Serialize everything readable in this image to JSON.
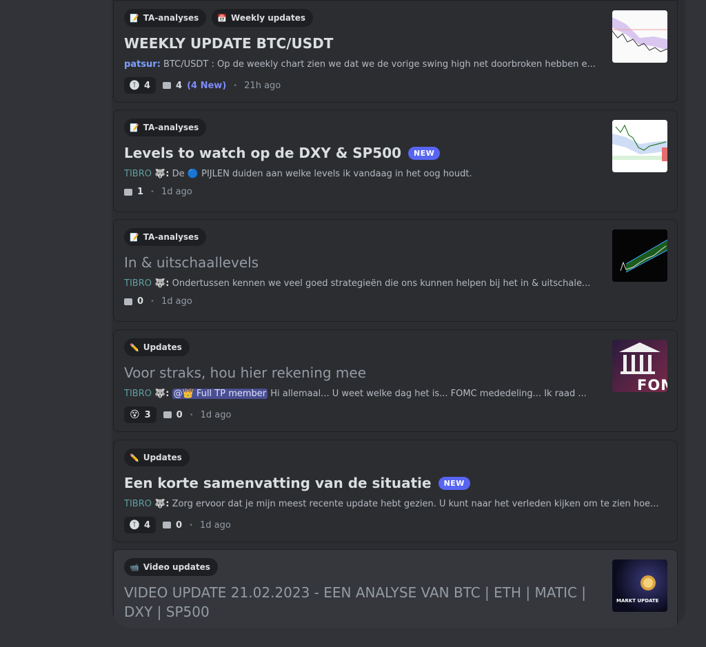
{
  "threads": [
    {
      "tags": [
        {
          "icon": "📝",
          "label": "TA-analyses"
        },
        {
          "icon": "📅",
          "label": "Weekly updates"
        }
      ],
      "title": "WEEKLY UPDATE BTC/USDT",
      "author": "patsur",
      "author_suffix": ":",
      "preview": "BTC/USDT : Op de weekly chart zien we dat we de vorige swing high net doorbroken hebben e...",
      "reaction": {
        "emoji": "🅣",
        "count": "4"
      },
      "comments": "4",
      "new_comments": "(4 New)",
      "time": "21h ago"
    },
    {
      "tags": [
        {
          "icon": "📝",
          "label": "TA-analyses"
        }
      ],
      "title": "Levels to watch op de DXY & SP500",
      "badge": "NEW",
      "author": "TIBRO 🐺",
      "author_suffix": ":",
      "preview_before": "De",
      "preview_icon": "🔵",
      "preview": "PIJLEN duiden aan welke levels ik vandaag in het oog houdt.",
      "comments": "1",
      "time": "1d ago"
    },
    {
      "tags": [
        {
          "icon": "📝",
          "label": "TA-analyses"
        }
      ],
      "title": "In & uitschaallevels",
      "author": "TIBRO 🐺",
      "author_suffix": ":",
      "preview": "Ondertussen kennen we veel goed strategieën die ons kunnen helpen bij het in & uitschale...",
      "comments": "0",
      "time": "1d ago"
    },
    {
      "tags": [
        {
          "icon": "✏️",
          "label": "Updates"
        }
      ],
      "title": "Voor straks, hou hier rekening mee",
      "author": "TIBRO 🐺",
      "author_suffix": ":",
      "mention": "@👑 Full TP member",
      "preview": "Hi allemaal... U weet welke dag het is... FOMC mededeling... Ik raad ...",
      "reaction": {
        "emoji": "😵",
        "count": "3"
      },
      "comments": "0",
      "time": "1d ago",
      "thumb_text": "FOM"
    },
    {
      "tags": [
        {
          "icon": "✏️",
          "label": "Updates"
        }
      ],
      "title": "Een korte samenvatting van de situatie",
      "badge": "NEW",
      "author": "TIBRO 🐺",
      "author_suffix": ":",
      "preview": "Zorg ervoor dat je mijn meest recente update hebt gezien. U kunt naar het verleden kijken om te zien hoe...",
      "reaction": {
        "emoji": "🅣",
        "count": "4"
      },
      "comments": "0",
      "time": "1d ago"
    },
    {
      "tags": [
        {
          "icon": "📹",
          "label": "Video updates"
        }
      ],
      "title_line1": "VIDEO UPDATE 21.02.2023 - EEN ANALYSE VAN BTC | ETH | MATIC |",
      "title_line2": "DXY | SP500",
      "thumb_text": "MARKT UPDATE"
    }
  ],
  "colors": {
    "background": "#313338",
    "card": "#2b2d31",
    "accent": "#5865f2",
    "author": "#5f9ea0"
  }
}
